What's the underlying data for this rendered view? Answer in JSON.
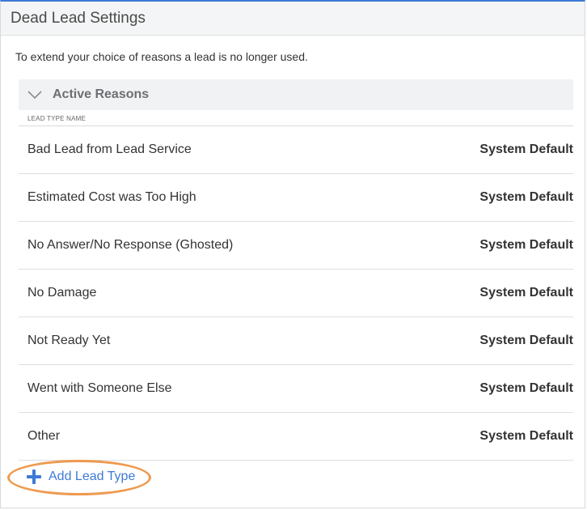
{
  "header": {
    "title": "Dead Lead Settings"
  },
  "description": "To extend your choice of reasons a lead is no longer used.",
  "section": {
    "title": "Active Reasons",
    "column_header": "LEAD TYPE NAME",
    "rows": [
      {
        "name": "Bad Lead from Lead Service",
        "status": "System Default"
      },
      {
        "name": "Estimated Cost was Too High",
        "status": "System Default"
      },
      {
        "name": "No Answer/No Response (Ghosted)",
        "status": "System Default"
      },
      {
        "name": "No Damage",
        "status": "System Default"
      },
      {
        "name": "Not Ready Yet",
        "status": "System Default"
      },
      {
        "name": "Went with Someone Else",
        "status": "System Default"
      },
      {
        "name": "Other",
        "status": "System Default"
      }
    ]
  },
  "add_button": {
    "label": "Add Lead Type",
    "icon": "plus-icon"
  },
  "colors": {
    "accent": "#3e7ad6",
    "highlight": "#ee9a4f"
  }
}
